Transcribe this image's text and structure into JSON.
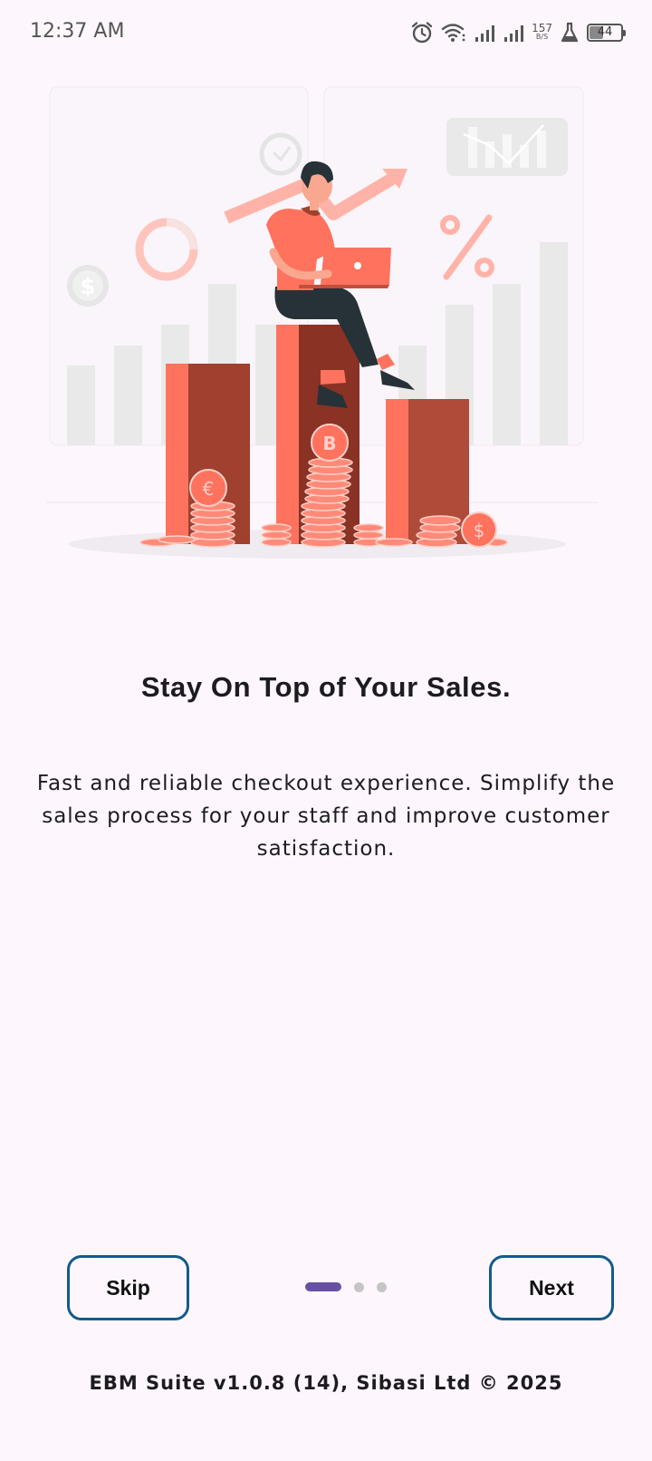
{
  "status_bar": {
    "time": "12:37 AM",
    "net_speed_value": "157",
    "net_speed_unit": "B/S",
    "battery_percent": "44",
    "icons": [
      "alarm-icon",
      "wifi-icon",
      "signal-icon",
      "signal-icon",
      "lab-flask-icon",
      "battery-icon"
    ]
  },
  "onboarding": {
    "illustration": "sales-growth-illustration",
    "title": "Stay On Top of Your Sales.",
    "description": "Fast and reliable checkout experience. Simplify the sales process for your staff and improve customer satisfaction.",
    "page_indicator": {
      "pages": 3,
      "current": 1
    }
  },
  "actions": {
    "skip_label": "Skip",
    "next_label": "Next"
  },
  "footer": {
    "text": "EBM Suite v1.0.8 (14), Sibasi Ltd © 2025"
  },
  "colors": {
    "background": "#fdf7fd",
    "button_border": "#125a8e",
    "indicator_active": "#6750a4",
    "indicator_inactive": "#c5c5c5",
    "illustration_accent": "#ff725e"
  }
}
